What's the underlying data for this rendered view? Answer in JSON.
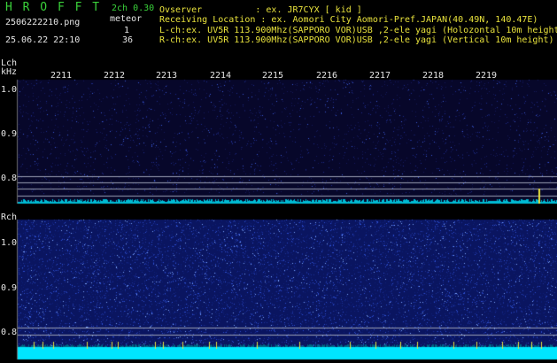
{
  "header": {
    "app_name": "H R O F F T",
    "version": "2ch 0.30",
    "filename": "2506222210.png",
    "datetime": "25.06.22 22:10",
    "meteor_label": "meteor",
    "l_count": "1",
    "r_count": "36",
    "observer_line": "Ovserver          : ex. JR7CYX [ kid ]",
    "location_line": "Receiving Location : ex. Aomori City Aomori-Pref.JAPAN(40.49N, 140.47E)",
    "lch_line": "L-ch:ex. UV5R 113.900Mhz(SAPPORO VOR)USB ,2-ele yagi (Holozontal 10m height)",
    "rch_line": "R-ch:ex. UV5R 113.900Mhz(SAPPORO VOR)USB ,2-ele yagi (Vertical 10m height)"
  },
  "time_ticks": [
    "2211",
    "2212",
    "2213",
    "2214",
    "2215",
    "2216",
    "2217",
    "2218",
    "2219"
  ],
  "lch": {
    "label": "Lch",
    "unit": "kHz",
    "y_ticks": [
      "1.0",
      "0.9",
      "0.8"
    ]
  },
  "rch": {
    "label": "Rch",
    "y_ticks": [
      "1.0",
      "0.9",
      "0.8"
    ]
  },
  "colors": {
    "text_green": "#3ad13a",
    "text_yellow": "#e8e23c",
    "panel_bg": "#0a0a2a",
    "trace": "#00e5ff"
  }
}
